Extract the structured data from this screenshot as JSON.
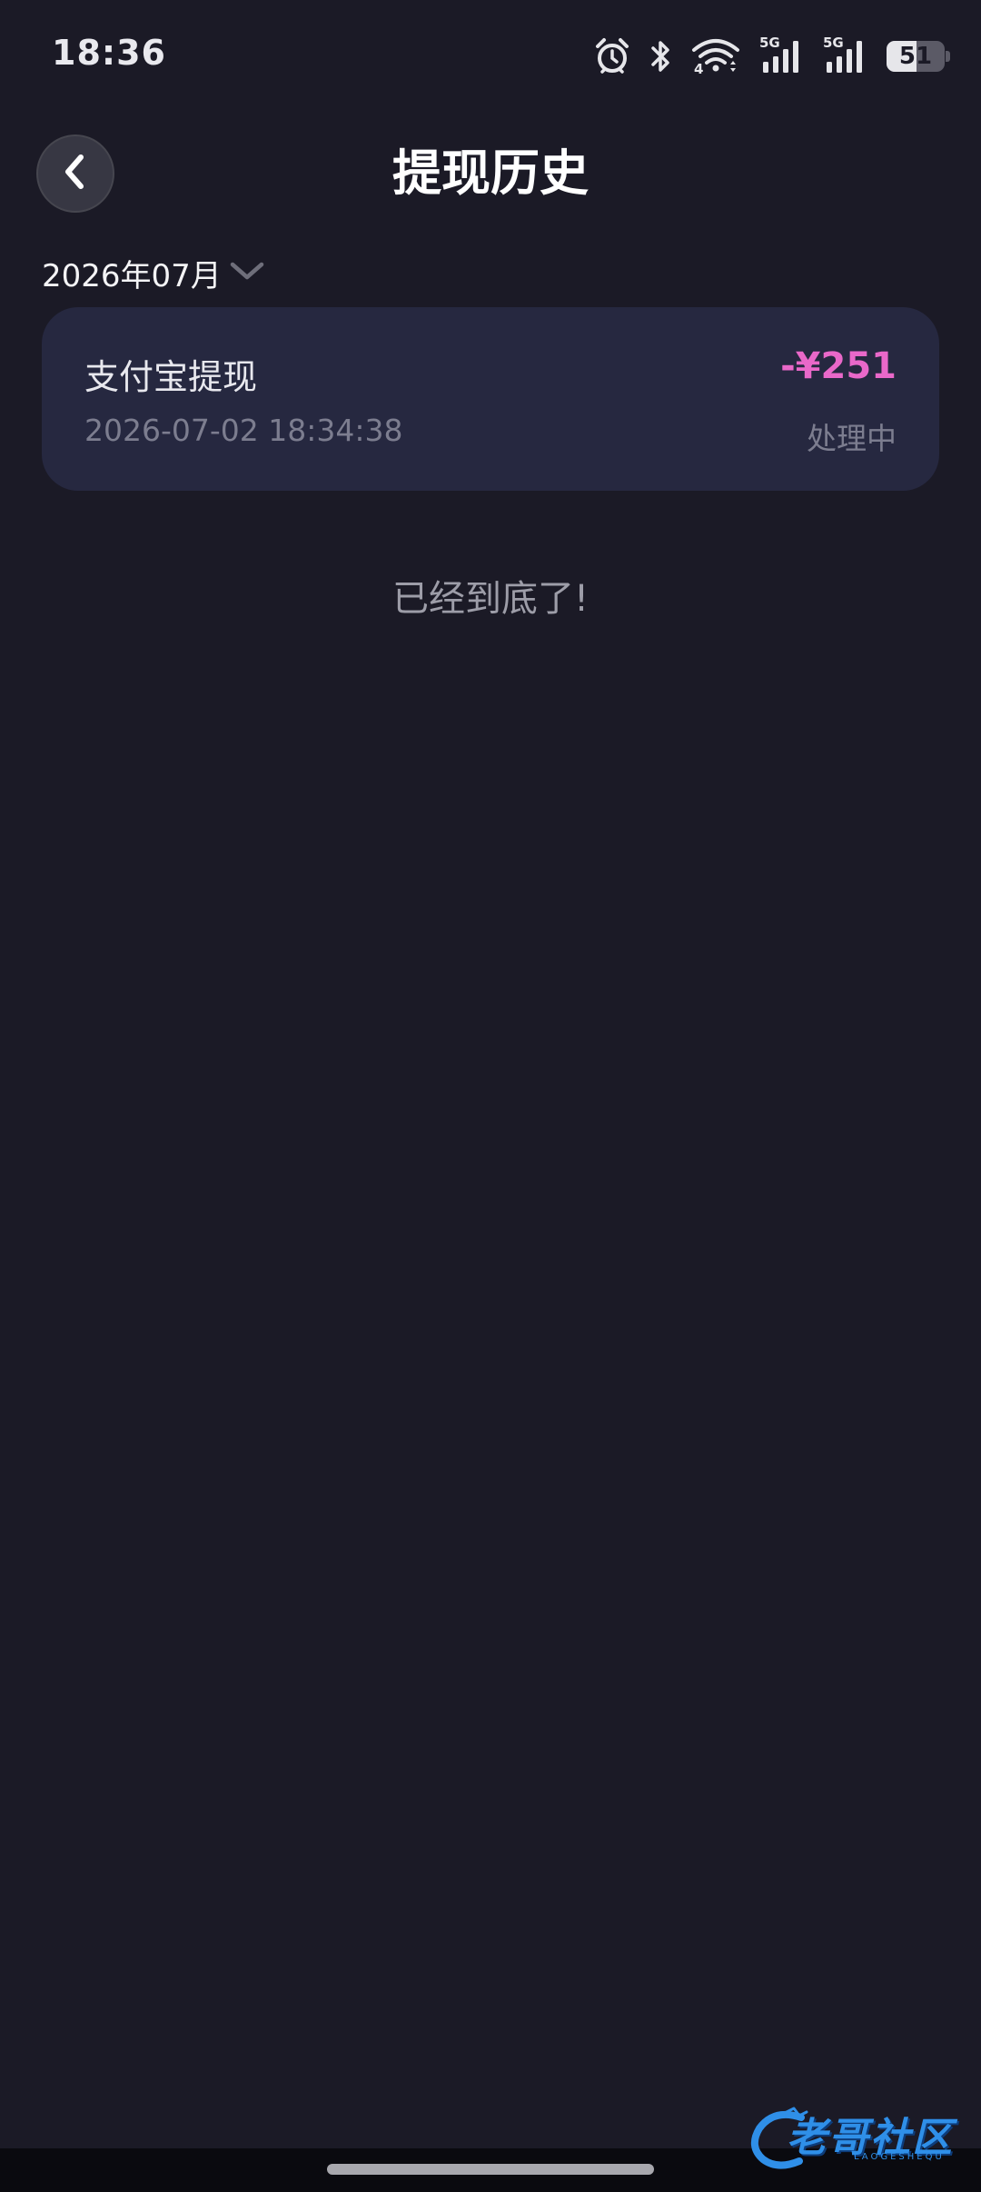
{
  "status_bar": {
    "time": "18:36",
    "icons": [
      "alarm-icon",
      "bluetooth-icon",
      "wifi-icon",
      "signal-5g-icon",
      "signal-5g-icon",
      "battery-icon"
    ],
    "wifi_sub_label": "4",
    "network_label_1": "5G",
    "network_label_2": "5G",
    "battery_level": "51"
  },
  "header": {
    "title": "提现历史",
    "back_icon": "chevron-left-icon"
  },
  "filter": {
    "month": "2026年07月",
    "icon": "chevron-down-icon"
  },
  "records": [
    {
      "title": "支付宝提现",
      "time": "2026-07-02 18:34:38",
      "amount": "-¥251",
      "status": "处理中"
    }
  ],
  "list_end_text": "已经到底了!",
  "watermark": {
    "text": "老哥社区",
    "subtext": "LAOGESHEQU"
  },
  "colors": {
    "background": "#1b1a26",
    "card": "#262840",
    "amount": "#e968c9",
    "muted_text": "#7c7d8f",
    "watermark": "#2f8fe8"
  }
}
